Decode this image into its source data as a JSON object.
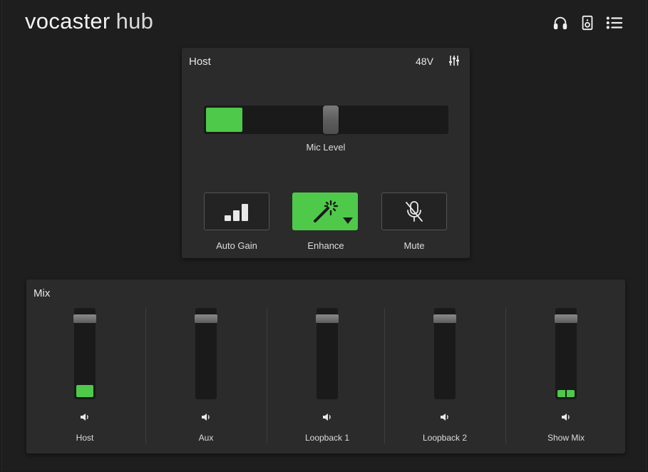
{
  "app": {
    "logo_word1": "vocaster",
    "logo_word2": "hub",
    "header_icons": [
      "headphones-icon",
      "speaker-box-icon",
      "menu-list-icon"
    ]
  },
  "host": {
    "title": "Host",
    "phantom_power": "48V",
    "settings_icon": "sliders-icon",
    "mic_level_label": "Mic Level",
    "mic_meter_fraction": 0.15,
    "mic_level_fraction": 0.52,
    "buttons": [
      {
        "label": "Auto Gain",
        "icon": "signal-bars-icon",
        "active": false
      },
      {
        "label": "Enhance",
        "icon": "magic-wand-icon",
        "active": true
      },
      {
        "label": "Mute",
        "icon": "mic-off-icon",
        "active": false
      }
    ]
  },
  "mix": {
    "title": "Mix",
    "channels": [
      {
        "label": "Host",
        "fader_level": 0.92,
        "meter_level": 0.14,
        "stereo": false
      },
      {
        "label": "Aux",
        "fader_level": 0.92,
        "meter_level": 0,
        "stereo": false
      },
      {
        "label": "Loopback 1",
        "fader_level": 0.92,
        "meter_level": 0,
        "stereo": false
      },
      {
        "label": "Loopback 2",
        "fader_level": 0.92,
        "meter_level": 0,
        "stereo": false
      },
      {
        "label": "Show Mix",
        "fader_level": 0.92,
        "meter_level": 0.08,
        "stereo": true
      }
    ]
  },
  "colors": {
    "accent_green": "#4fc94a",
    "panel": "#2b2b2b",
    "background": "#1e1e1e"
  }
}
